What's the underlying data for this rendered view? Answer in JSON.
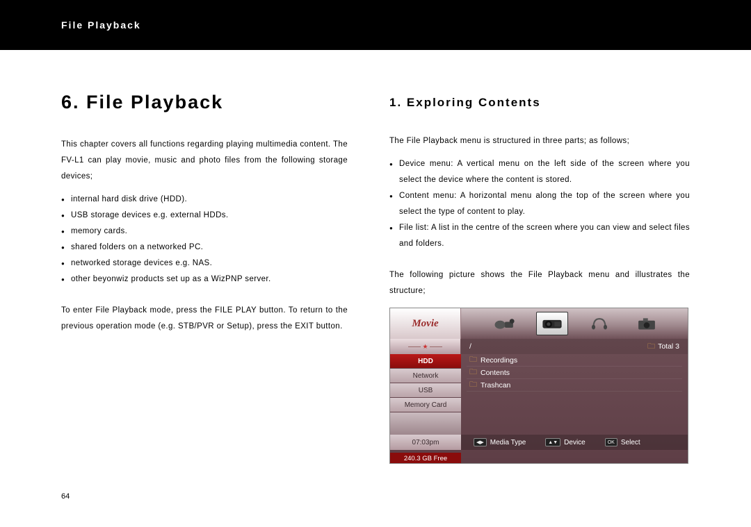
{
  "header": {
    "title": "File Playback"
  },
  "page_number": "64",
  "left": {
    "chapter_title": "6. File Playback",
    "intro": "This chapter covers all functions regarding playing multimedia content. The FV-L1 can play movie, music and photo files from the following storage devices;",
    "storage_list": [
      "internal hard disk drive (HDD).",
      "USB storage devices e.g. external HDDs.",
      "memory cards.",
      "shared folders on a networked PC.",
      "networked storage devices e.g. NAS.",
      "other beyonwiz products set up as a WizPNP server."
    ],
    "after": "To enter File Playback mode, press the FILE PLAY button.   To return to the previous operation mode (e.g. STB/PVR or Setup), press the EXIT button."
  },
  "right": {
    "section_title": "1. Exploring Contents",
    "intro": "The File Playback menu is structured in three parts; as follows;",
    "parts": [
      "Device menu: A vertical menu on the left side of the screen where you select the device where the content is stored.",
      "Content menu: A horizontal menu along the top of the screen where you select the type of content to play.",
      "File list: A list in the centre of the screen where you can view and select files and folders."
    ],
    "after": "The following picture shows the File Playback menu and illustrates the structure;"
  },
  "ui": {
    "movie_label": "Movie",
    "path": "/",
    "total_label": "Total 3",
    "sidebar": [
      {
        "label": "HDD"
      },
      {
        "label": "Network"
      },
      {
        "label": "USB"
      },
      {
        "label": "Memory Card"
      }
    ],
    "files": [
      {
        "name": "Recordings"
      },
      {
        "name": "Contents"
      },
      {
        "name": "Trashcan"
      }
    ],
    "time": "07:03pm",
    "free": "240.3 GB Free",
    "hints": [
      {
        "key": "◀▶",
        "label": "Media Type"
      },
      {
        "key": "▲▼",
        "label": "Device"
      },
      {
        "key": "OK",
        "label": "Select"
      }
    ]
  }
}
